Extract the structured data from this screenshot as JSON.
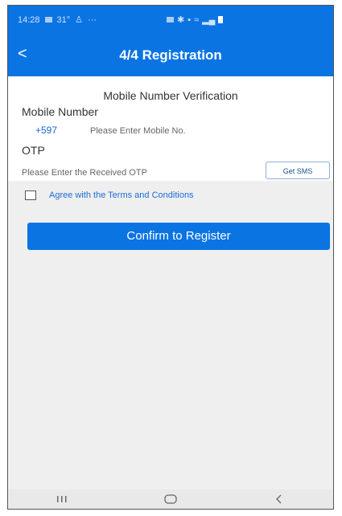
{
  "status_bar": {
    "time": "14:28",
    "temp": "31°",
    "dots": "···"
  },
  "header": {
    "back_icon": "chevron-left-icon",
    "back_glyph": "<",
    "title": "4/4 Registration"
  },
  "verification": {
    "heading": "Mobile Number Verification",
    "mobile_label": "Mobile Number",
    "country_code": "+597",
    "mobile_placeholder": "Please Enter Mobile No.",
    "mobile_value": "",
    "otp_label": "OTP",
    "otp_placeholder": "Please Enter the Received OTP",
    "otp_value": "",
    "get_sms_label": "Get SMS"
  },
  "terms": {
    "checked": false,
    "label": "Agree with the Terms and Conditions"
  },
  "confirm": {
    "label": "Confirm to Register"
  },
  "nav": {
    "icons": [
      "recent-apps-icon",
      "home-icon",
      "back-icon"
    ]
  },
  "colors": {
    "accent": "#0a74e3",
    "link": "#1a6dd4",
    "page_bg": "#efefef"
  }
}
